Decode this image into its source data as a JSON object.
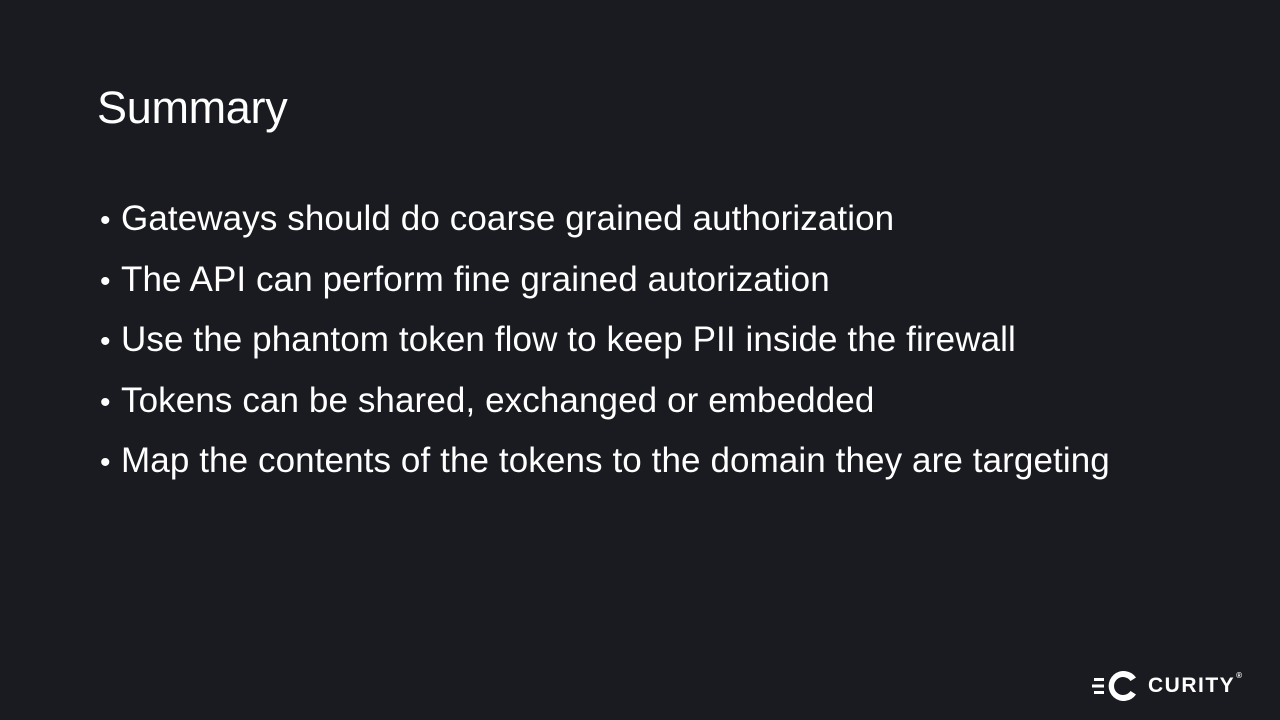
{
  "slide": {
    "title": "Summary",
    "bullets": [
      "Gateways should do coarse grained authorization",
      "The API can perform fine grained autorization",
      "Use the phantom token flow to keep PII inside the firewall",
      "Tokens can be shared, exchanged or embedded",
      "Map the contents of the tokens to the domain they are targeting"
    ],
    "bullet_glyph": "•"
  },
  "logo": {
    "name": "CURITY",
    "mark": "®",
    "icon": "curity-logo-icon"
  },
  "colors": {
    "background": "#1a1b20",
    "text": "#ffffff",
    "grid_line": "#2b2c33",
    "grid_accent": "#c0407a"
  }
}
